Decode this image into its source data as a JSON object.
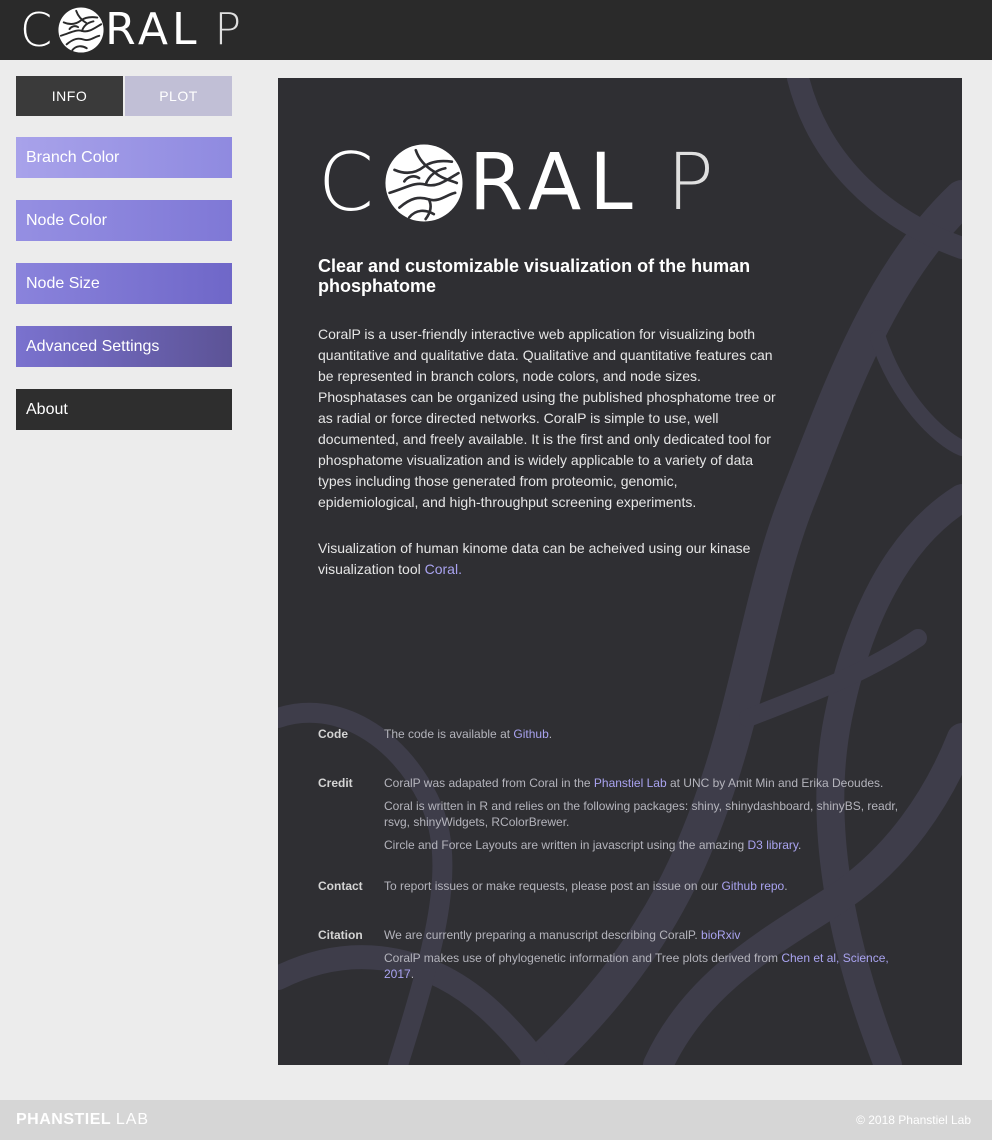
{
  "header": {
    "logo": {
      "c": "C",
      "word": "RAL",
      "p": "P"
    }
  },
  "sidebar": {
    "tabs": [
      {
        "label": "INFO",
        "active": true
      },
      {
        "label": "PLOT",
        "active": false
      }
    ],
    "sections": [
      {
        "label": "Branch Color"
      },
      {
        "label": "Node Color"
      },
      {
        "label": "Node Size"
      },
      {
        "label": "Advanced Settings"
      },
      {
        "label": "About"
      }
    ]
  },
  "main": {
    "logo": {
      "c": "C",
      "word": "RAL",
      "p": "P"
    },
    "tagline": "Clear and customizable visualization of the human phosphatome",
    "description": "CoralP is a user-friendly interactive web application for visualizing both quantitative and qualitative data. Qualitative and quantitative features can be represented in branch colors, node colors, and node sizes. Phosphatases can be organized using the published phosphatome tree or as radial or force directed networks. CoralP is simple to use, well documented, and freely available. It is the first and only dedicated tool for phosphatome visualization and is widely applicable to a variety of data types including those generated from proteomic, genomic, epidemiological, and high-throughput screening experiments.",
    "kinome": {
      "text": "Visualization of human kinome data can be acheived using our kinase visualization tool ",
      "link": "Coral."
    },
    "info": {
      "code": {
        "label": "Code",
        "text": "The code is available at ",
        "link": "Github",
        "after": "."
      },
      "credit": {
        "label": "Credit",
        "line1_before": "CoralP was adapated from Coral in the ",
        "line1_link": "Phanstiel Lab",
        "line1_after": " at UNC by Amit Min and Erika Deoudes.",
        "line2": "Coral is written in R and relies on the following packages: shiny, shinydashboard, shinyBS, readr, rsvg, shinyWidgets, RColorBrewer.",
        "line3_before": "Circle and Force Layouts are written in javascript using the amazing ",
        "line3_link": "D3 library",
        "line3_after": "."
      },
      "contact": {
        "label": "Contact",
        "text": "To report issues or make requests, please post an issue on our ",
        "link": "Github repo",
        "after": "."
      },
      "citation": {
        "label": "Citation",
        "line1": "We are currently preparing a manuscript describing CoralP. ",
        "line1_link": "bioRxiv",
        "line2": "CoralP makes use of phylogenetic information and Tree plots derived from ",
        "line2_link": "Chen et al, Science, 2017",
        "line2_after": "."
      }
    }
  },
  "footer": {
    "brand": "PHANSTIEL",
    "brand_suffix": "LAB",
    "copyright": "© 2018 Phanstiel Lab"
  },
  "colors": {
    "header_bg": "#2a2a2a",
    "panel_bg": "#2f2f33",
    "accent": "#8f8ae0",
    "link": "#a9a3f0",
    "footer_bg": "#d6d6d6"
  }
}
